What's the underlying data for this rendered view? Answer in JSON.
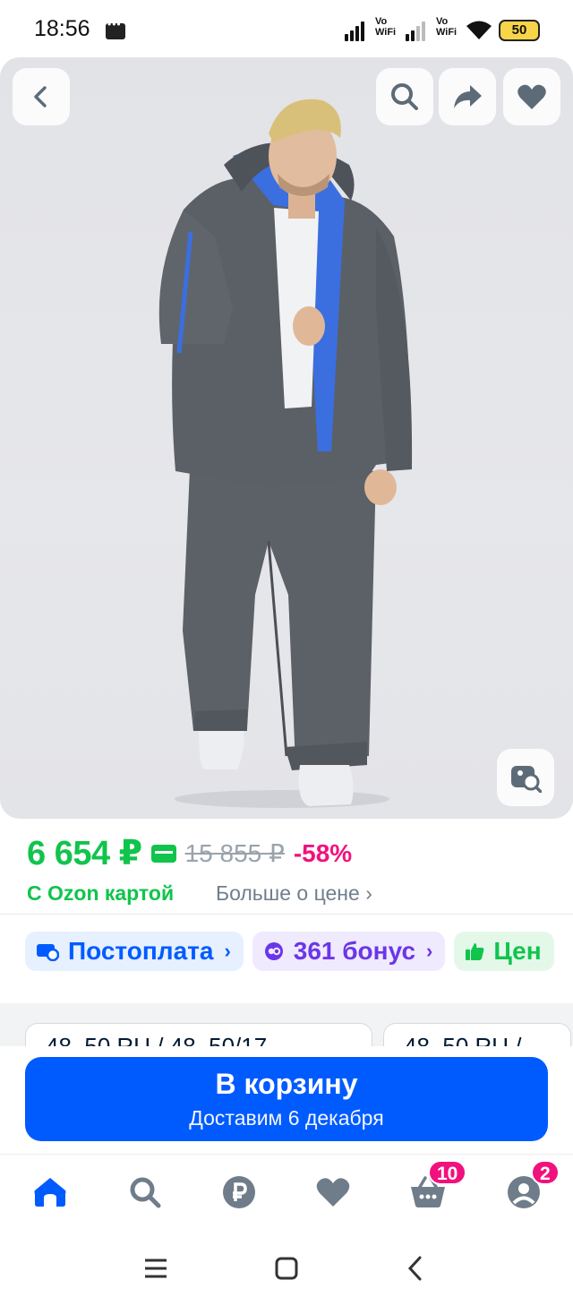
{
  "status_bar": {
    "time": "18:56",
    "vowifi_1": "Vo\nWiFi",
    "vowifi_1_top": "Vo",
    "vowifi_1_bottom": "WiFi",
    "vowifi_2_top": "Vo",
    "vowifi_2_bottom": "WiFi",
    "battery": "50"
  },
  "image_controls": {
    "back_icon": "chevron-left-icon",
    "search_icon": "search-icon",
    "share_icon": "share-icon",
    "favorite_icon": "heart-icon",
    "visual_search_icon": "image-search-icon"
  },
  "price": {
    "current": "6 654 ₽",
    "old": "15 855 ₽",
    "discount": "-58%",
    "ozon_card": "С Ozon картой",
    "more": "Больше о цене ›"
  },
  "chips": [
    {
      "label": "Постоплата",
      "icon": "card-clock-icon",
      "color": "#005bff"
    },
    {
      "label": "361 бонус",
      "icon": "bonus-icon",
      "color": "#6b36e8"
    },
    {
      "label": "Цен",
      "icon": "thumb-up-icon",
      "color": "#10c44c"
    }
  ],
  "variants": [
    {
      "label": "48–50 RU / 48–50/17…"
    },
    {
      "label": "48–50 RU / …"
    }
  ],
  "cart": {
    "title": "В корзину",
    "subtitle": "Доставим 6 декабря"
  },
  "bottom_nav": {
    "items": [
      {
        "name": "home",
        "icon": "home-icon",
        "active": true
      },
      {
        "name": "search",
        "icon": "search-icon"
      },
      {
        "name": "ruble",
        "icon": "ruble-icon"
      },
      {
        "name": "favorites",
        "icon": "heart-icon"
      },
      {
        "name": "cart",
        "icon": "basket-icon",
        "badge": "10"
      },
      {
        "name": "profile",
        "icon": "profile-icon",
        "badge": "2"
      }
    ]
  },
  "colors": {
    "accent": "#005bff",
    "price_green": "#10c44c",
    "discount_pink": "#f1117e"
  }
}
